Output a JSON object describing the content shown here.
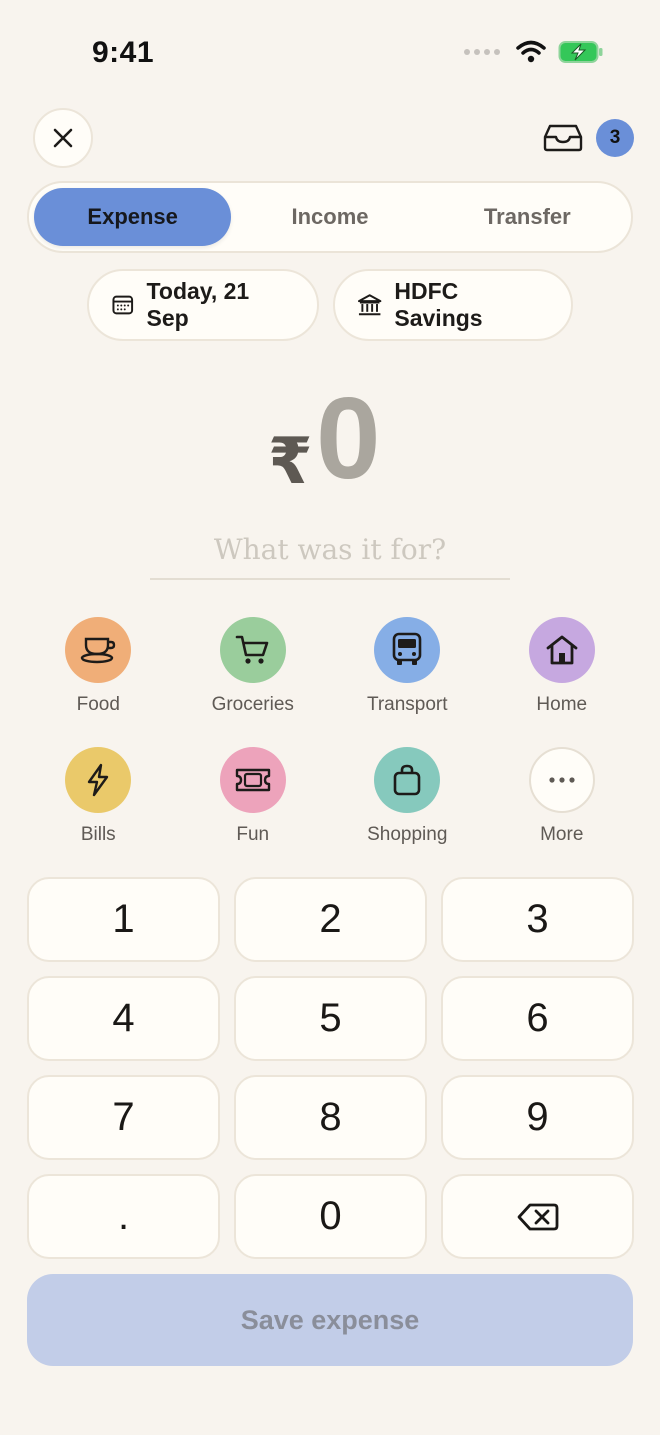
{
  "status_bar": {
    "time": "9:41"
  },
  "header": {
    "inbox_badge": "3"
  },
  "tabs": [
    {
      "label": "Expense",
      "active": true
    },
    {
      "label": "Income",
      "active": false
    },
    {
      "label": "Transfer",
      "active": false
    }
  ],
  "chips": {
    "date": "Today, 21 Sep",
    "account": "HDFC Savings"
  },
  "amount": {
    "currency": "₹",
    "value": "0"
  },
  "note": {
    "placeholder": "What was it for?"
  },
  "categories": [
    {
      "label": "Food",
      "color": "#f0ae78",
      "icon": "coffee-cup-icon"
    },
    {
      "label": "Groceries",
      "color": "#9acd9c",
      "icon": "cart-icon"
    },
    {
      "label": "Transport",
      "color": "#86aee6",
      "icon": "bus-icon"
    },
    {
      "label": "Home",
      "color": "#c6a8e0",
      "icon": "home-icon"
    },
    {
      "label": "Bills",
      "color": "#eac96a",
      "icon": "bolt-icon"
    },
    {
      "label": "Fun",
      "color": "#eda3bb",
      "icon": "ticket-icon"
    },
    {
      "label": "Shopping",
      "color": "#86c9bd",
      "icon": "bag-icon"
    },
    {
      "label": "More",
      "color": "#fffdf8",
      "icon": "more-icon"
    }
  ],
  "keypad": [
    "1",
    "2",
    "3",
    "4",
    "5",
    "6",
    "7",
    "8",
    "9",
    ".",
    "0"
  ],
  "save_label": "Save expense"
}
